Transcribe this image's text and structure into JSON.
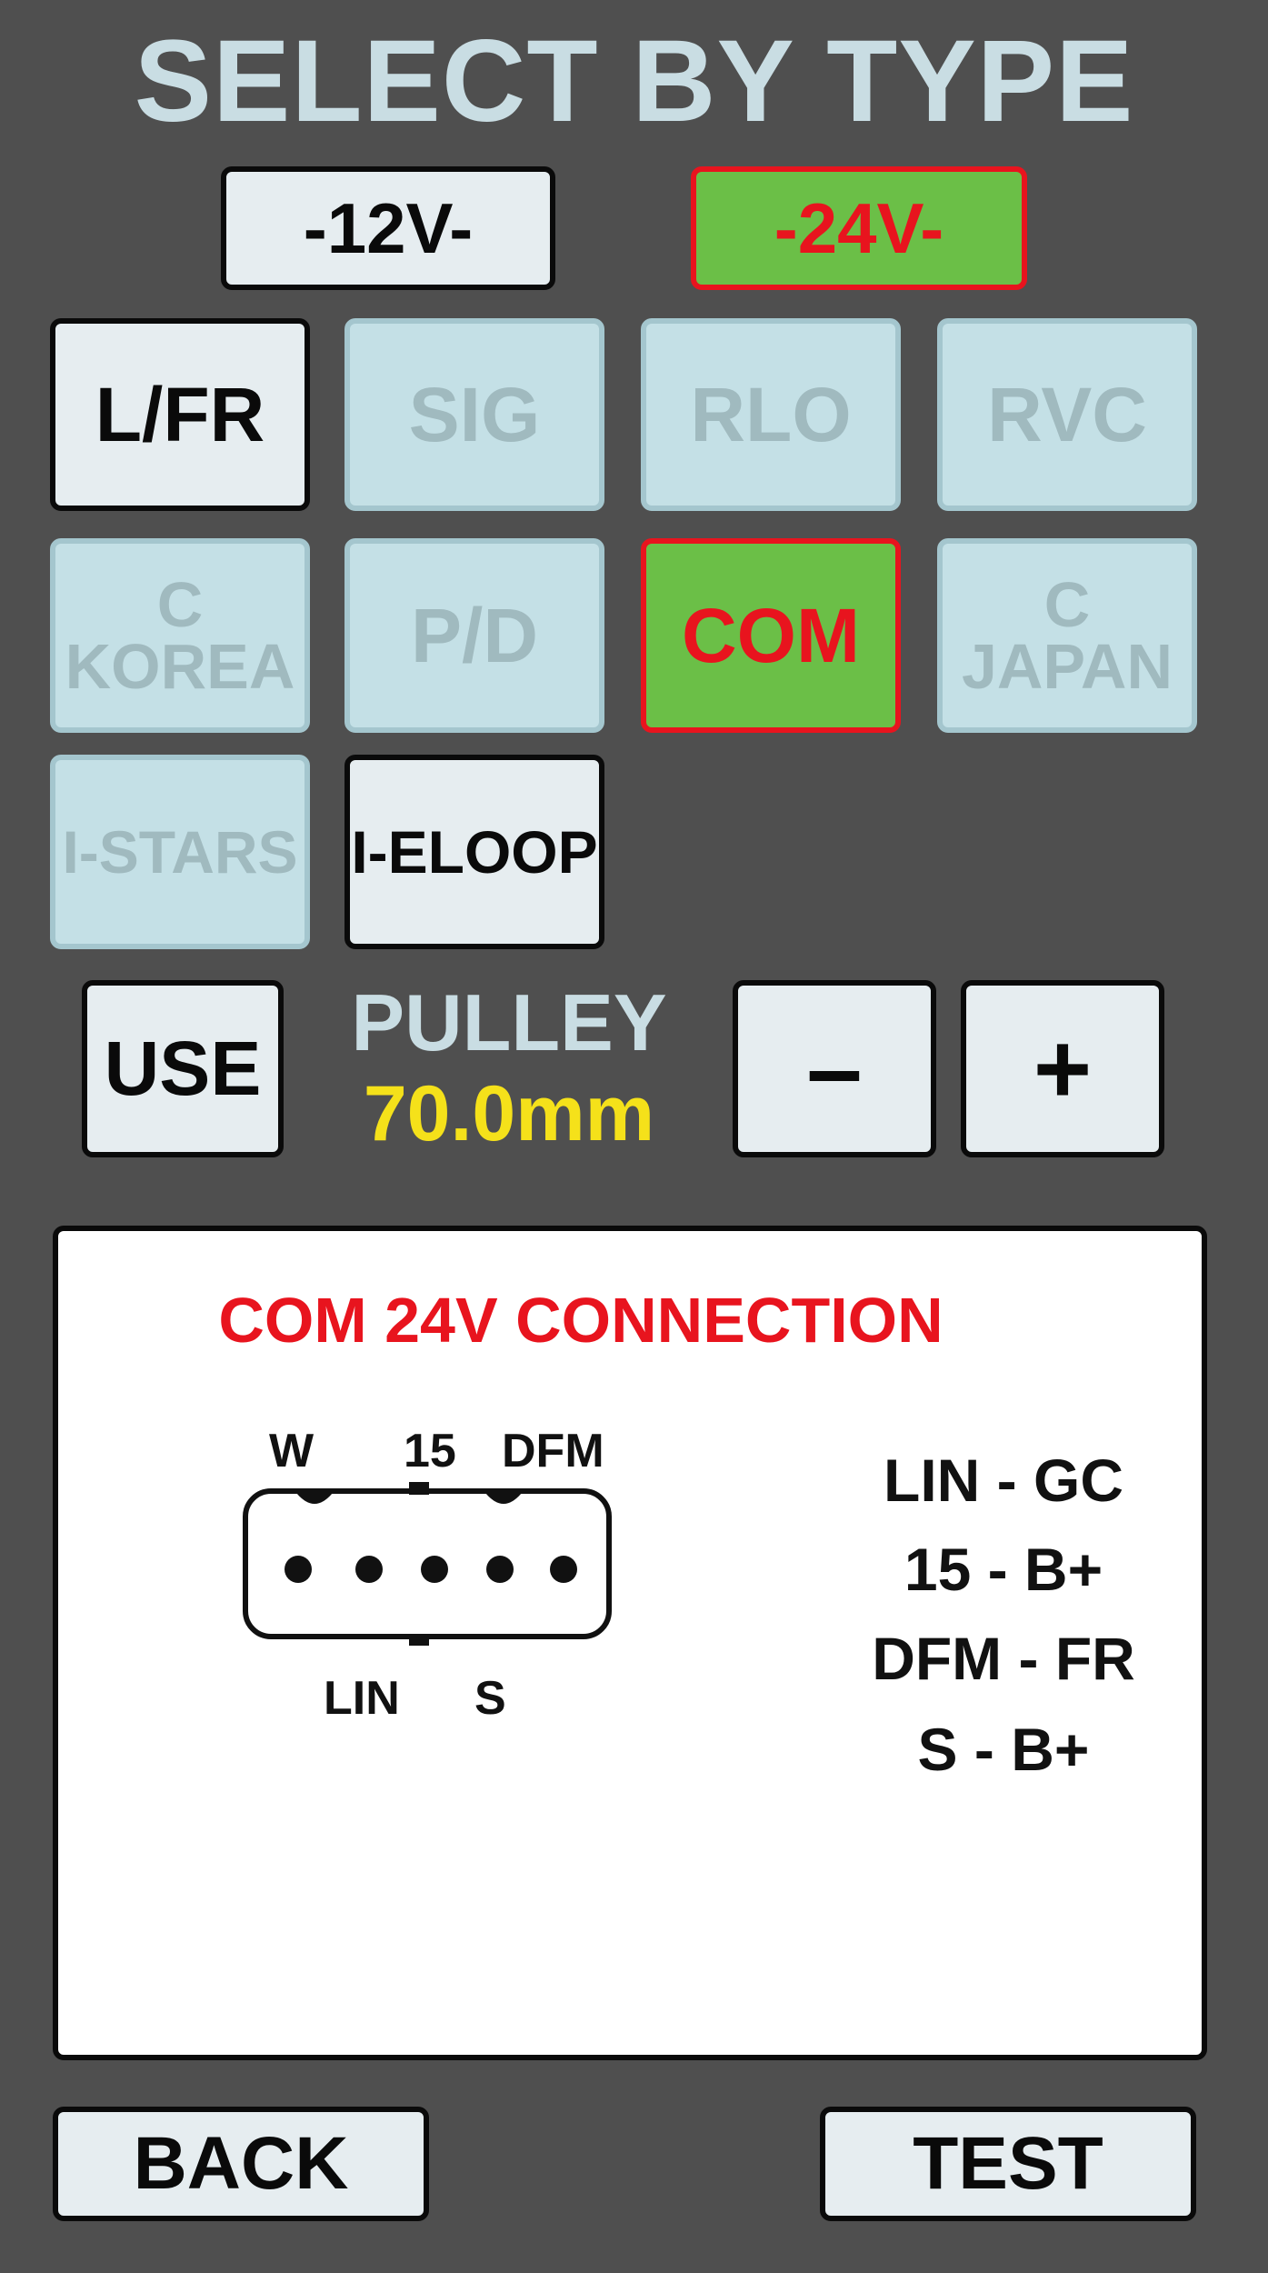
{
  "header": {
    "title": "SELECT BY TYPE"
  },
  "voltage": {
    "v12": "-12V-",
    "v24": "-24V-"
  },
  "types": {
    "lfr": "L/FR",
    "sig": "SIG",
    "rlo": "RLO",
    "rvc": "RVC",
    "c_korea": "C\nKOREA",
    "pd": "P/D",
    "com": "COM",
    "c_japan": "C\nJAPAN",
    "i_stars": "I-STARS",
    "i_eloop": "I-ELOOP"
  },
  "pulley": {
    "use_label": "USE",
    "label": "PULLEY",
    "value": "70.0mm",
    "minus_label": "–",
    "plus_label": "+"
  },
  "connection": {
    "title": "COM 24V CONNECTION",
    "pins_top": {
      "w": "W",
      "p15": "15",
      "dfm": "DFM"
    },
    "pins_bottom": {
      "lin": "LIN",
      "s": "S"
    },
    "mapping": [
      "LIN - GC",
      "15 - B+",
      "DFM - FR",
      "S - B+"
    ]
  },
  "footer": {
    "back_label": "BACK",
    "test_label": "TEST"
  },
  "colors": {
    "background": "#4f4f4f",
    "selected_fill": "#6bbf47",
    "selected_text": "#e8141e",
    "pulley_value": "#f5e11a"
  }
}
